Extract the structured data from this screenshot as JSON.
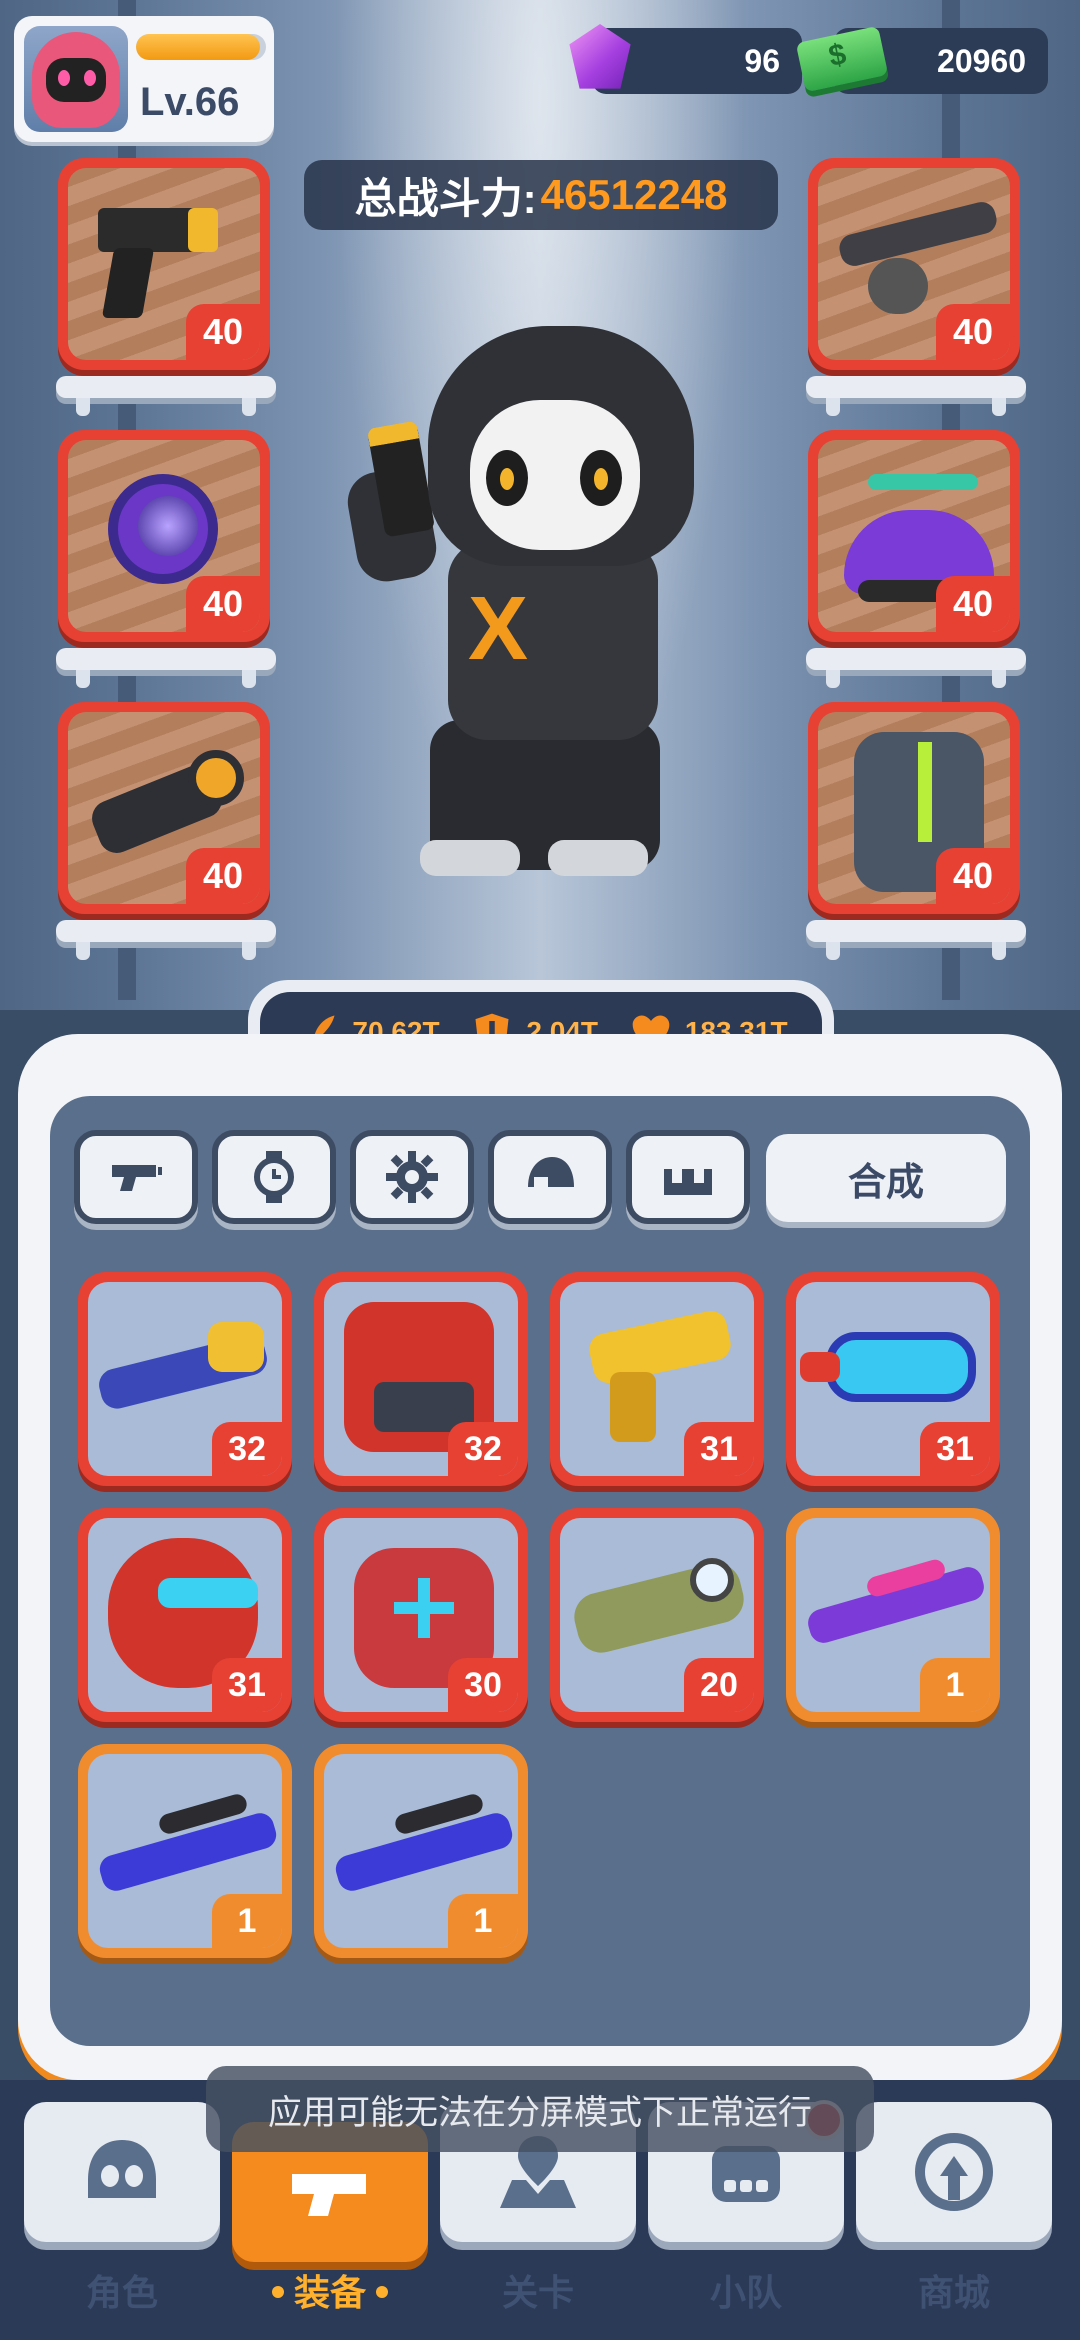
{
  "player": {
    "level": "Lv.66",
    "xp_fraction": 0.95
  },
  "currency": {
    "gems": "96",
    "cash": "20960"
  },
  "power": {
    "label": "总战斗力:",
    "value": "46512248"
  },
  "equipped": {
    "left": [
      {
        "name": "pistol",
        "level": "40"
      },
      {
        "name": "watch",
        "level": "40"
      },
      {
        "name": "scope",
        "level": "40"
      }
    ],
    "right": [
      {
        "name": "shotgun",
        "level": "40"
      },
      {
        "name": "propeller-cap",
        "level": "40"
      },
      {
        "name": "backpack",
        "level": "40"
      }
    ]
  },
  "stats": {
    "attack": "70.62T",
    "defense": "2.04T",
    "health": "183.31T"
  },
  "tabs": {
    "synthesize_label": "合成"
  },
  "inventory": [
    {
      "name": "blaster-rifle",
      "level": "32",
      "rarity": "red"
    },
    {
      "name": "red-armor",
      "level": "32",
      "rarity": "red"
    },
    {
      "name": "gold-pistol",
      "level": "31",
      "rarity": "red"
    },
    {
      "name": "goggles",
      "level": "31",
      "rarity": "red"
    },
    {
      "name": "red-helmet",
      "level": "31",
      "rarity": "red"
    },
    {
      "name": "gauntlet",
      "level": "30",
      "rarity": "red"
    },
    {
      "name": "plasma-gun",
      "level": "20",
      "rarity": "red"
    },
    {
      "name": "purple-sniper",
      "level": "1",
      "rarity": "orange"
    },
    {
      "name": "blue-sniper",
      "level": "1",
      "rarity": "orange"
    },
    {
      "name": "blue-sniper",
      "level": "1",
      "rarity": "orange"
    }
  ],
  "toast": "应用可能无法在分屏模式下正常运行",
  "nav": [
    "角色",
    "装备",
    "关卡",
    "小队",
    "商城"
  ],
  "colors": {
    "accent": "#f58a1f",
    "rare_red": "#e64133",
    "rare_orange": "#f18c2e"
  }
}
